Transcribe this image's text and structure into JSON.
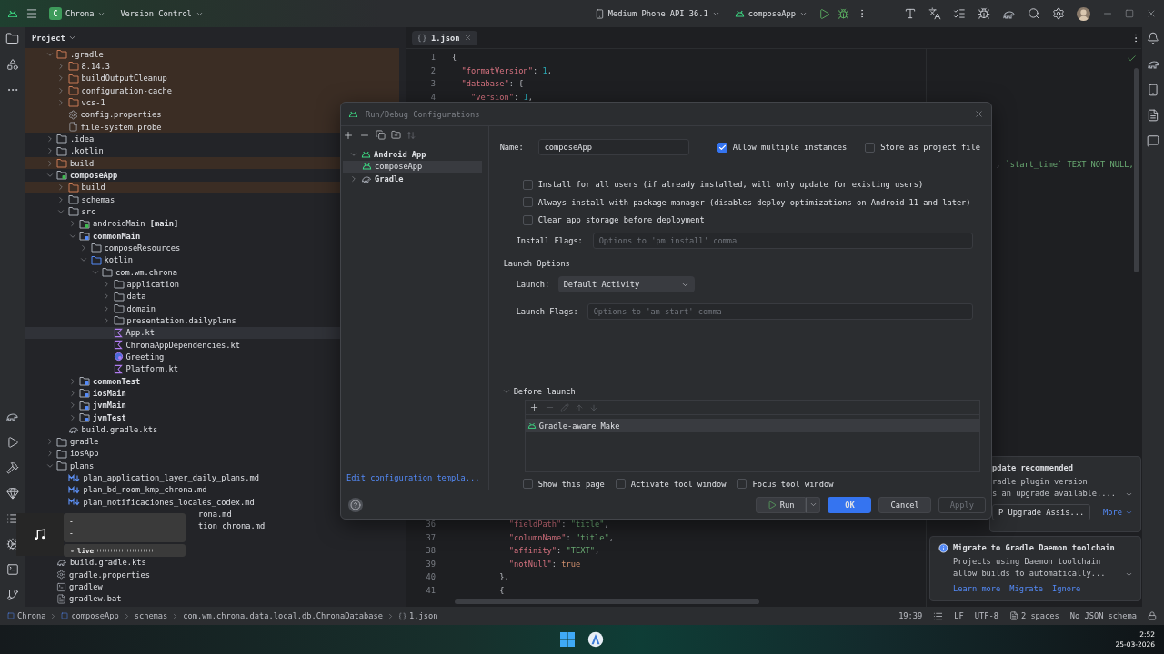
{
  "top_bar": {
    "project_badge": "C",
    "project": "Chrona",
    "vcs": "Version Control",
    "device": "Medium Phone API 36.1",
    "run_config": "composeApp"
  },
  "project_panel": {
    "title": "Project",
    "tree": [
      {
        "label": ".gradle",
        "kind": "folder",
        "excluded": true,
        "selected": false,
        "expanded": true,
        "children": [
          {
            "label": "8.14.3",
            "kind": "folder",
            "excluded": true,
            "selected": false,
            "expanded": false
          },
          {
            "label": "buildOutputCleanup",
            "kind": "folder",
            "excluded": true,
            "selected": false,
            "expanded": false
          },
          {
            "label": "configuration-cache",
            "kind": "folder",
            "excluded": true,
            "selected": false,
            "expanded": false
          },
          {
            "label": "vcs-1",
            "kind": "folder",
            "excluded": true,
            "selected": false,
            "expanded": false
          },
          {
            "label": "config.properties",
            "kind": "gear",
            "excluded": true,
            "selected": false
          },
          {
            "label": "file-system.probe",
            "kind": "probe",
            "excluded": true,
            "selected": false
          }
        ]
      },
      {
        "label": ".idea",
        "kind": "folder",
        "excluded": false,
        "selected": false,
        "expanded": false
      },
      {
        "label": ".kotlin",
        "kind": "folder",
        "excluded": false,
        "selected": false,
        "expanded": false
      },
      {
        "label": "build",
        "kind": "folder",
        "excluded": true,
        "selected": false,
        "expanded": false
      },
      {
        "label": "composeApp",
        "kind": "module",
        "excluded": false,
        "selected": false,
        "expanded": true,
        "children": [
          {
            "label": "build",
            "kind": "folder",
            "excluded": true,
            "selected": false,
            "expanded": false
          },
          {
            "label": "schemas",
            "kind": "folder",
            "excluded": false,
            "selected": false,
            "expanded": false
          },
          {
            "label": "src",
            "kind": "folder",
            "excluded": false,
            "selected": false,
            "expanded": true,
            "children": [
              {
                "label": "androidMain **[main]**",
                "kind": "android-source",
                "excluded": false,
                "selected": false,
                "expanded": false
              },
              {
                "label": "commonMain",
                "kind": "source",
                "excluded": false,
                "selected": false,
                "expanded": true,
                "children": [
                  {
                    "label": "composeResources",
                    "kind": "folder",
                    "excluded": false,
                    "selected": false,
                    "expanded": false
                  },
                  {
                    "label": "kotlin",
                    "kind": "root",
                    "excluded": false,
                    "selected": false,
                    "expanded": true,
                    "children": [
                      {
                        "label": "com.wm.chrona",
                        "kind": "folder",
                        "excluded": false,
                        "selected": false,
                        "expanded": true,
                        "children": [
                          {
                            "label": "application",
                            "kind": "folder",
                            "excluded": false,
                            "selected": false,
                            "expanded": false
                          },
                          {
                            "label": "data",
                            "kind": "folder",
                            "excluded": false,
                            "selected": false,
                            "expanded": false
                          },
                          {
                            "label": "domain",
                            "kind": "folder",
                            "excluded": false,
                            "selected": false,
                            "expanded": false
                          },
                          {
                            "label": "presentation.dailyplans",
                            "kind": "folder",
                            "excluded": false,
                            "selected": false,
                            "expanded": false
                          },
                          {
                            "label": "App.kt",
                            "kind": "kotlin",
                            "excluded": false,
                            "selected": true
                          },
                          {
                            "label": "ChronaAppDependencies.kt",
                            "kind": "kotlin",
                            "excluded": false,
                            "selected": false
                          },
                          {
                            "label": "Greeting",
                            "kind": "compose",
                            "excluded": false,
                            "selected": false
                          },
                          {
                            "label": "Platform.kt",
                            "kind": "kotlin",
                            "excluded": false,
                            "selected": false
                          }
                        ]
                      }
                    ]
                  }
                ]
              },
              {
                "label": "commonTest",
                "kind": "source",
                "excluded": false,
                "selected": false,
                "expanded": false
              },
              {
                "label": "iosMain",
                "kind": "source",
                "excluded": false,
                "selected": false,
                "expanded": false
              },
              {
                "label": "jvmMain",
                "kind": "source",
                "excluded": false,
                "selected": false,
                "expanded": false
              },
              {
                "label": "jvmTest",
                "kind": "source",
                "excluded": false,
                "selected": false,
                "expanded": false
              }
            ]
          },
          {
            "label": "build.gradle.kts",
            "kind": "gradle",
            "excluded": false,
            "selected": false
          }
        ]
      },
      {
        "label": "gradle",
        "kind": "folder",
        "excluded": false,
        "selected": false,
        "expanded": false
      },
      {
        "label": "iosApp",
        "kind": "folder",
        "excluded": false,
        "selected": false,
        "expanded": false
      },
      {
        "label": "plans",
        "kind": "folder",
        "excluded": false,
        "selected": false,
        "expanded": true,
        "children": [
          {
            "label": "plan_application_layer_daily_plans.md",
            "kind": "markdown",
            "excluded": false,
            "selected": false
          },
          {
            "label": "plan_bd_room_kmp_chrona.md",
            "kind": "markdown",
            "excluded": false,
            "selected": false
          },
          {
            "label": "plan_notificaciones_locales_codex.md",
            "kind": "markdown",
            "excluded": false,
            "selected": false
          },
          {
            "label": "rona.md",
            "kind": "fragment",
            "excluded": false,
            "selected": false
          },
          {
            "label": "tion_chrona.md",
            "kind": "fragment",
            "excluded": false,
            "selected": false
          }
        ]
      },
      {
        "label": "build.gradle.kts",
        "kind": "gradle",
        "excluded": false,
        "selected": false
      },
      {
        "label": "gradle.properties",
        "kind": "gear",
        "excluded": false,
        "selected": false
      },
      {
        "label": "gradlew",
        "kind": "terminal",
        "excluded": false,
        "selected": false
      },
      {
        "label": "gradlew.bat",
        "kind": "script",
        "excluded": false,
        "selected": false
      }
    ]
  },
  "editor": {
    "tabs": [
      {
        "label": "1.json",
        "selected": true
      }
    ],
    "top_lines": [
      {
        "num": "1",
        "tokens": [
          {
            "kind": "punct",
            "text": "{"
          }
        ]
      },
      {
        "num": "2",
        "tokens": [
          {
            "kind": "key",
            "text": "  \"formatVersion\""
          },
          {
            "kind": "punct",
            "text": ": "
          },
          {
            "kind": "number",
            "text": "1"
          },
          {
            "kind": "punct",
            "text": ","
          }
        ]
      },
      {
        "num": "3",
        "tokens": [
          {
            "kind": "key",
            "text": "  \"database\""
          },
          {
            "kind": "punct",
            "text": ": {"
          }
        ]
      },
      {
        "num": "4",
        "tokens": [
          {
            "kind": "key",
            "text": "    \"version\""
          },
          {
            "kind": "punct",
            "text": ": "
          },
          {
            "kind": "number",
            "text": "1"
          },
          {
            "kind": "punct",
            "text": ","
          }
        ]
      }
    ],
    "fragment_line": [
      {
        "kind": "punct",
        "text": ", "
      },
      {
        "kind": "string",
        "text": "`start_time` TEXT NOT NULL, "
      }
    ],
    "bottom_lines": [
      {
        "num": "36",
        "tokens": [
          {
            "kind": "key",
            "text": "            \"fieldPath\""
          },
          {
            "kind": "punct",
            "text": ": "
          },
          {
            "kind": "string",
            "text": "\"title\""
          },
          {
            "kind": "punct",
            "text": ","
          }
        ]
      },
      {
        "num": "37",
        "tokens": [
          {
            "kind": "key",
            "text": "            \"columnName\""
          },
          {
            "kind": "punct",
            "text": ": "
          },
          {
            "kind": "string",
            "text": "\"title\""
          },
          {
            "kind": "punct",
            "text": ","
          }
        ]
      },
      {
        "num": "38",
        "tokens": [
          {
            "kind": "key",
            "text": "            \"affinity\""
          },
          {
            "kind": "punct",
            "text": ": "
          },
          {
            "kind": "string",
            "text": "\"TEXT\""
          },
          {
            "kind": "punct",
            "text": ","
          }
        ]
      },
      {
        "num": "39",
        "tokens": [
          {
            "kind": "key",
            "text": "            \"notNull\""
          },
          {
            "kind": "punct",
            "text": ": "
          },
          {
            "kind": "keyword",
            "text": "true"
          }
        ]
      },
      {
        "num": "40",
        "tokens": [
          {
            "kind": "punct",
            "text": "          },"
          }
        ]
      },
      {
        "num": "41",
        "tokens": [
          {
            "kind": "punct",
            "text": "          {"
          }
        ]
      }
    ]
  },
  "dialog": {
    "title": "Run/Debug Configurations",
    "config_tree": [
      {
        "label": "Android App",
        "kind": "android",
        "selected": false,
        "expanded": true,
        "children": [
          {
            "label": "composeApp",
            "kind": "android",
            "selected": true
          }
        ]
      },
      {
        "label": "Gradle",
        "kind": "gradle",
        "selected": false,
        "expanded": false
      }
    ],
    "templates_link": "Edit configuration templa...",
    "name": {
      "label": "Name:",
      "value": "composeApp"
    },
    "top_checks": [
      {
        "label": "Allow multiple instances",
        "checked": true
      },
      {
        "label": "Store as project file",
        "checked": false
      }
    ],
    "options": [
      {
        "label": "Install for all users (if already installed, will only update for existing users)",
        "checked": false
      },
      {
        "label": "Always install with package manager (disables deploy optimizations on Android 11 and later)",
        "checked": false
      },
      {
        "label": "Clear app storage before deployment",
        "checked": false
      }
    ],
    "install_flags": {
      "label": "Install Flags:",
      "placeholder": "Options to 'pm install' comma"
    },
    "launch_options": {
      "title": "Launch Options",
      "launch_label": "Launch:",
      "launch_value": "Default Activity",
      "flags_label": "Launch Flags:",
      "flags_placeholder": "Options to 'am start' comma"
    },
    "before_launch": {
      "title": "Before launch",
      "expanded": true,
      "tasks": [
        {
          "label": "Gradle-aware Make",
          "selected": true
        }
      ]
    },
    "bottom_checks": [
      {
        "label": "Show this page",
        "checked": false
      },
      {
        "label": "Activate tool window",
        "checked": false
      },
      {
        "label": "Focus tool window",
        "checked": false
      }
    ],
    "buttons": [
      {
        "label": "Run",
        "kind": "split",
        "disabled": false
      },
      {
        "label": "OK",
        "kind": "primary",
        "disabled": false
      },
      {
        "label": "Cancel",
        "kind": "plain",
        "disabled": false
      },
      {
        "label": "Apply",
        "kind": "plain",
        "disabled": true
      }
    ]
  },
  "notifications": [
    {
      "kind": "partial",
      "title": "pdate recommended",
      "lines": [
        "radle plugin version",
        "s an upgrade available...."
      ],
      "actions": [
        {
          "label": "P Upgrade Assis...",
          "kind": "button"
        },
        {
          "label": "More",
          "kind": "menu"
        }
      ]
    },
    {
      "kind": "info",
      "title": "Migrate to Gradle Daemon toolchain",
      "lines": [
        "Projects using Daemon toolchain",
        "allow builds to automatically..."
      ],
      "actions": [
        {
          "label": "Learn more",
          "kind": "link"
        },
        {
          "label": "Migrate",
          "kind": "link"
        },
        {
          "label": "Ignore",
          "kind": "link"
        }
      ]
    }
  ],
  "media_flyout": {
    "title": "-",
    "subtitle": "-",
    "badge": "live"
  },
  "status_bar": {
    "breadcrumbs": [
      {
        "label": "Chrona",
        "kind": "module"
      },
      {
        "label": "composeApp",
        "kind": "module"
      },
      {
        "label": "schemas",
        "kind": "folder"
      },
      {
        "label": "com.wm.chrona.data.local.db.ChronaDatabase",
        "kind": "folder"
      },
      {
        "label": "1.json",
        "kind": "json"
      }
    ],
    "position": "19:39",
    "line_ending": "LF",
    "encoding": "UTF-8",
    "indent": "2 spaces",
    "schema": "No JSON schema"
  },
  "taskbar": {
    "time": "2:52",
    "date": "25-03-2026"
  }
}
